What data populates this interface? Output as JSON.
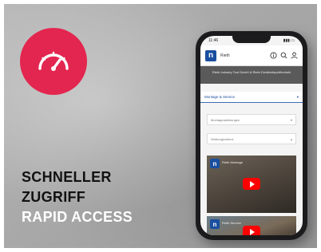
{
  "promo": {
    "headline_line1": "SCHNELLER",
    "headline_line2": "ZUGRIFF",
    "headline_line3": "RAPID ACCESS",
    "badge_icon": "speedometer-icon",
    "badge_color": "#e3264f"
  },
  "phone": {
    "status_time": "11:46",
    "app_title": "Rieth",
    "banner_text": "Rieth Industry Tool GmbH & Rieth Dichtheitsprüftechnik",
    "section_label": "Montage & Service",
    "dropdown1_label": "Montageanleitungen",
    "dropdown2_label": "Wartungsvideos",
    "video1_title": "Rieth Montage",
    "video2_title": "Rieth Service",
    "brand_color": "#1a4fa0",
    "play_color": "#ff0000"
  }
}
